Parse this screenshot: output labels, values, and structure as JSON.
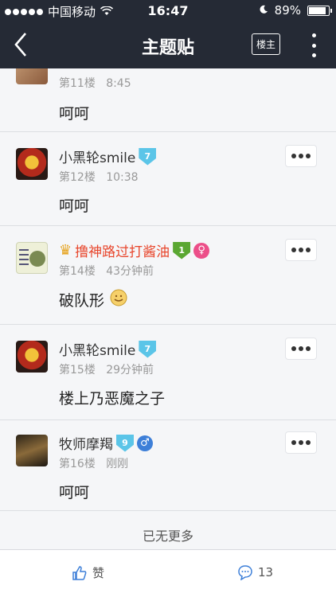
{
  "status": {
    "carrier": "中国移动",
    "time": "16:47",
    "battery": "89%",
    "battery_level": 0.89
  },
  "nav": {
    "title": "主题贴",
    "louzhu_label": "楼主"
  },
  "posts": [
    {
      "user": "",
      "floor": "第11楼",
      "time": "8:45",
      "content": "呵呵"
    },
    {
      "user": "小黑轮smile",
      "level": "7",
      "floor": "第12楼",
      "time": "10:38",
      "content": "呵呵"
    },
    {
      "user": "撸神路过打酱油",
      "level": "1",
      "floor": "第14楼",
      "time": "43分钟前",
      "content": "破队形"
    },
    {
      "user": "小黑轮smile",
      "level": "7",
      "floor": "第15楼",
      "time": "29分钟前",
      "content": "楼上乃恶魔之子"
    },
    {
      "user": "牧师摩羯",
      "level": "9",
      "floor": "第16楼",
      "time": "刚刚",
      "content": "呵呵"
    }
  ],
  "list_end": "已无更多",
  "footer": {
    "like_label": "赞",
    "comment_count": "13"
  },
  "colors": {
    "nav_bg": "#252a35",
    "level_blue": "#5bc5e8",
    "level_green": "#5aa732",
    "female": "#ec4f89",
    "male": "#3d7fd8",
    "highlight_name": "#e8462c"
  }
}
